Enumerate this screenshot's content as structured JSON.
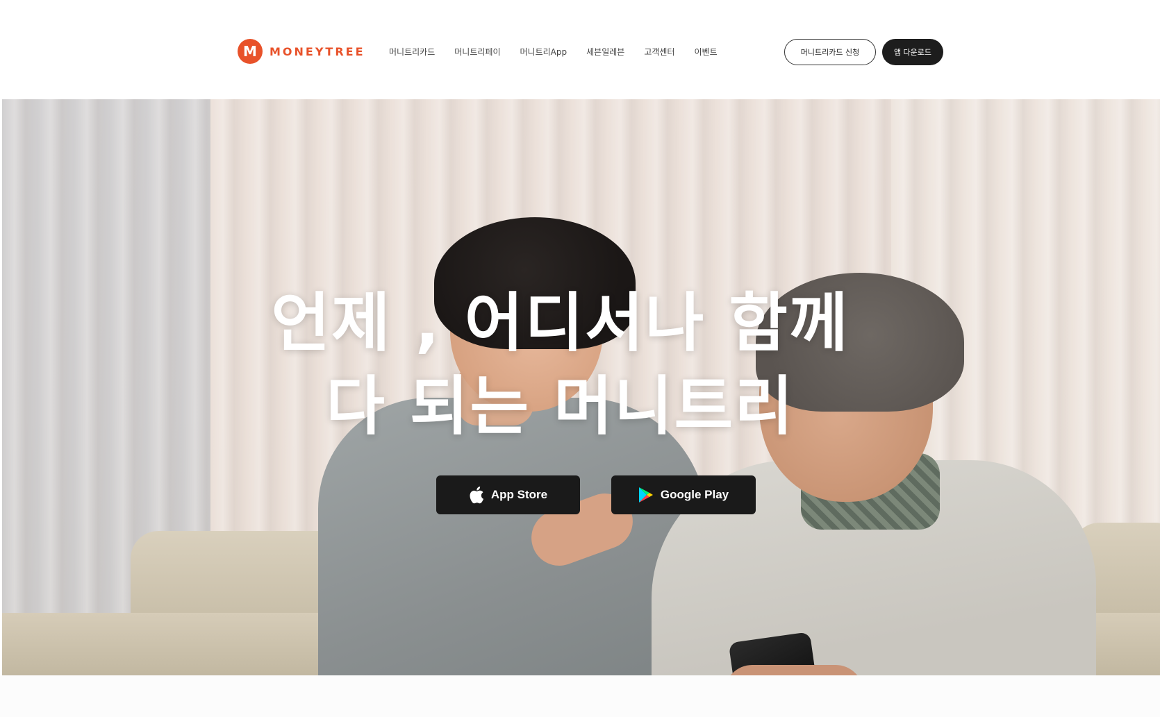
{
  "header": {
    "logo_mark": "M",
    "logo_text": "MONEYTREE",
    "nav": [
      {
        "label": "머니트리카드"
      },
      {
        "label": "머니트리페이"
      },
      {
        "label": "머니트리App"
      },
      {
        "label": "세븐일레븐"
      },
      {
        "label": "고객센터"
      },
      {
        "label": "이벤트"
      }
    ],
    "cta_outline": "머니트리카드 신청",
    "cta_dark": "앱 다운로드"
  },
  "hero": {
    "headline_line1": "언제 , 어디서나 함께",
    "headline_line2": "다 되는 머니트리",
    "app_store_label": "App Store",
    "google_play_label": "Google Play"
  },
  "colors": {
    "brand": "#e8522a",
    "button_dark": "#1a1a1a"
  },
  "icons": {
    "app_store": "apple-icon",
    "google_play": "google-play-icon"
  }
}
